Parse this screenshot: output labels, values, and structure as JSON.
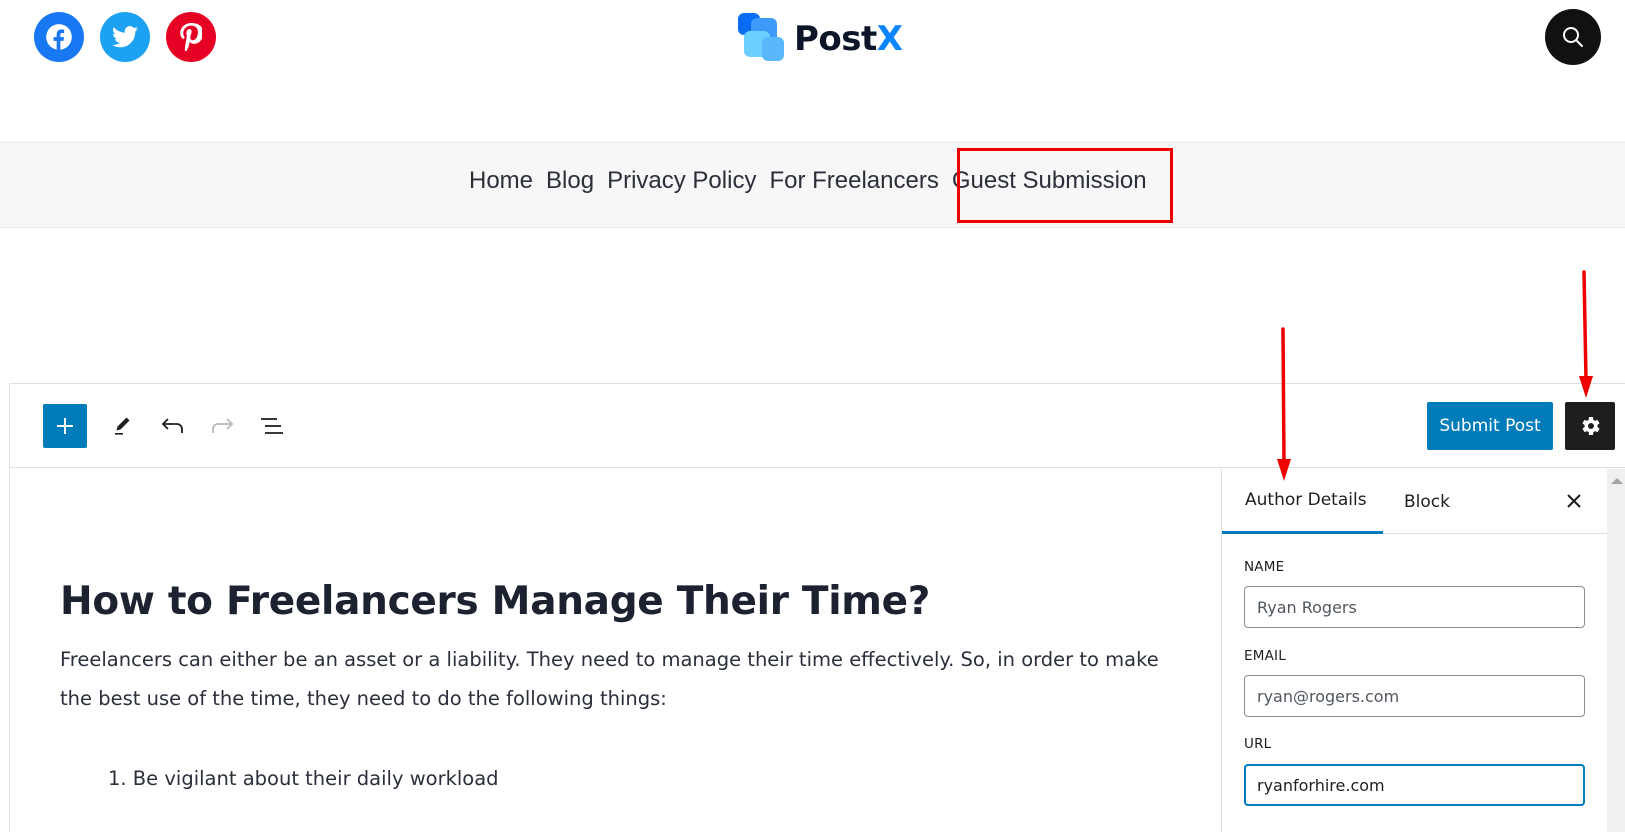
{
  "header": {
    "social": [
      {
        "name": "facebook",
        "icon": "facebook-icon",
        "color": "#1877f2"
      },
      {
        "name": "twitter",
        "icon": "twitter-icon",
        "color": "#1da1f2"
      },
      {
        "name": "pinterest",
        "icon": "pinterest-icon",
        "color": "#e60023"
      }
    ],
    "logo": {
      "text_main": "Post",
      "text_accent": "X",
      "accent_color": "#0a84ff"
    },
    "search_icon": "search-icon"
  },
  "nav": {
    "items": [
      {
        "label": "Home"
      },
      {
        "label": "Blog"
      },
      {
        "label": "Privacy Policy"
      },
      {
        "label": "For Freelancers"
      },
      {
        "label": "Guest Submission",
        "highlighted": true
      }
    ],
    "highlight_color": "#ee0000"
  },
  "editor": {
    "toolbar": {
      "add_block_icon": "plus-icon",
      "tools_icon": "pencil-icon",
      "undo_icon": "undo-icon",
      "redo_icon": "redo-icon",
      "outline_icon": "list-view-icon",
      "submit_label": "Submit Post",
      "settings_icon": "gear-icon",
      "accent_color": "#007cba"
    },
    "post": {
      "title": "How to Freelancers Manage Their Time?",
      "paragraph": "Freelancers can either be an asset or a liability. They need to manage their time effectively. So, in order to make the best use of the time, they need to do the following things:",
      "list": [
        "1. Be vigilant about their daily workload"
      ]
    },
    "sidebar": {
      "tabs": [
        {
          "label": "Author Details",
          "active": true
        },
        {
          "label": "Block",
          "active": false
        }
      ],
      "close_icon": "close-icon",
      "fields": {
        "name": {
          "label": "NAME",
          "value": "Ryan Rogers"
        },
        "email": {
          "label": "EMAIL",
          "value": "ryan@rogers.com"
        },
        "url": {
          "label": "URL",
          "value": "ryanforhire.com",
          "focused": true
        }
      }
    }
  },
  "annotations": {
    "arrows": [
      "arrow-to-author-details-tab",
      "arrow-to-settings-button"
    ],
    "arrow_color": "#ee0000"
  }
}
